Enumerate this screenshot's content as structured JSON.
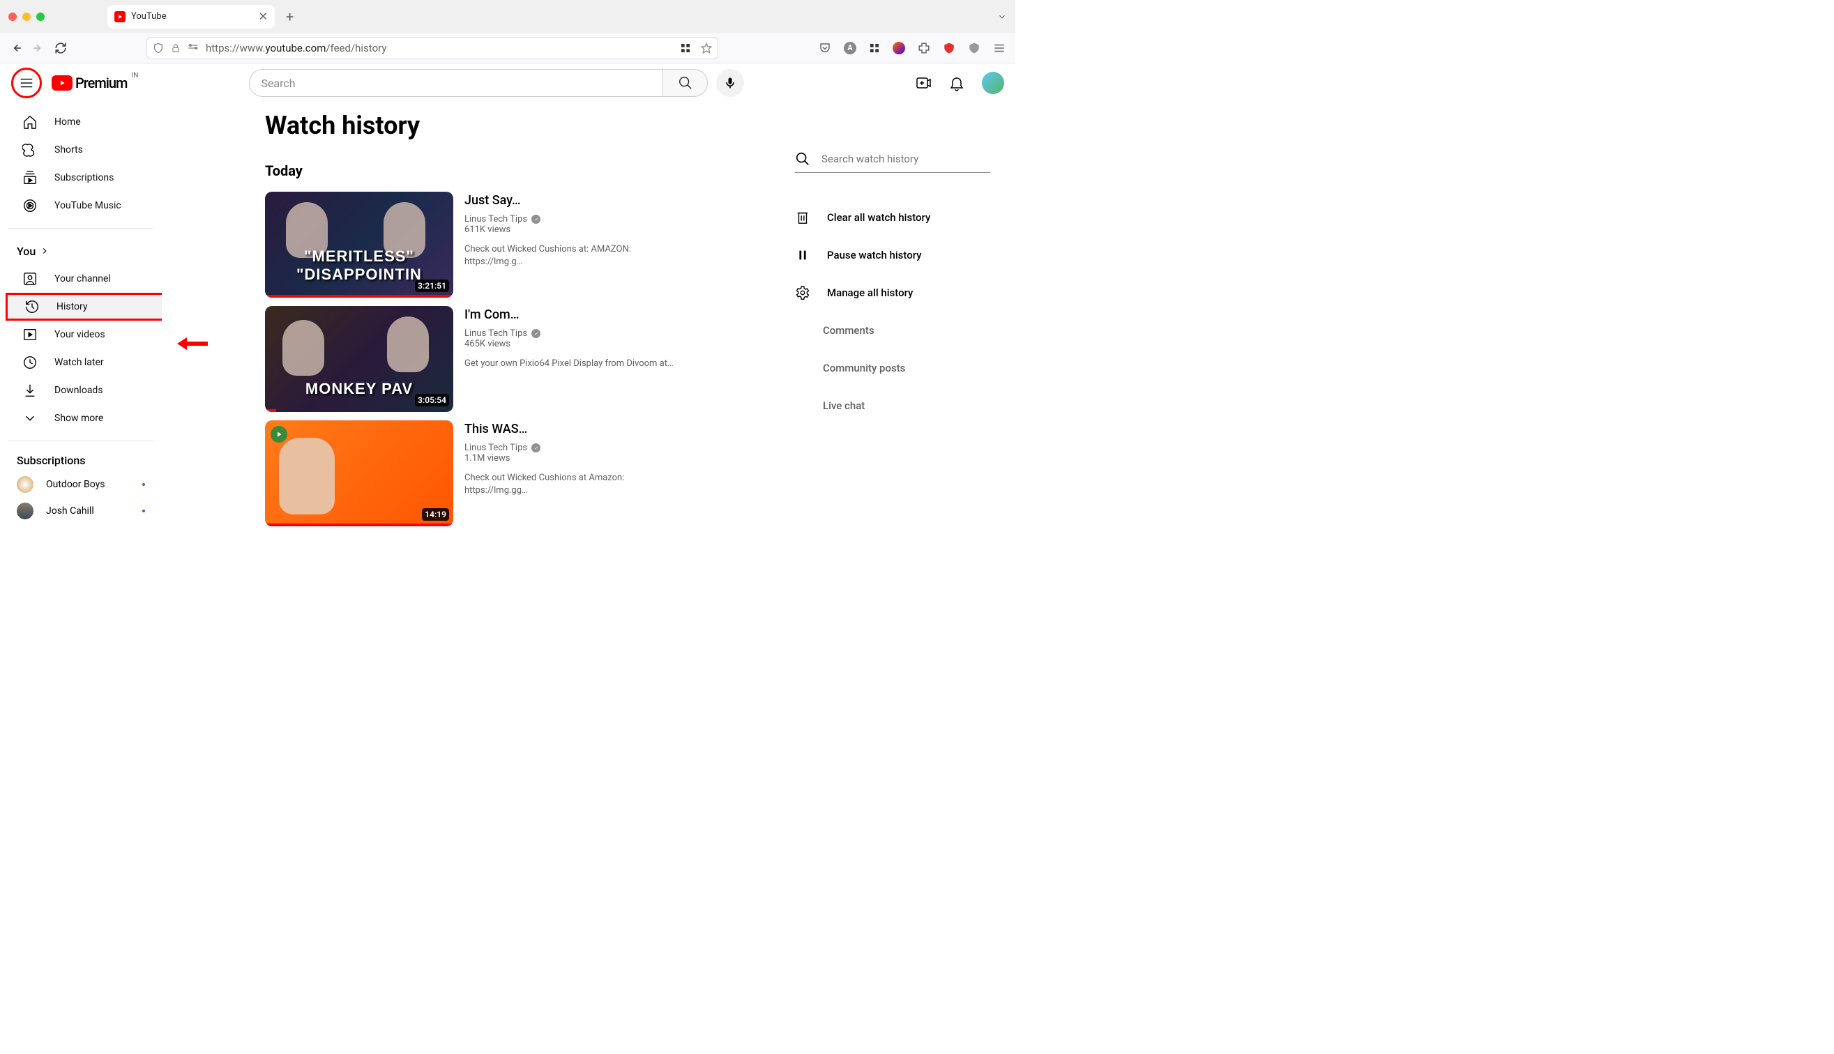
{
  "browser": {
    "tab_title": "YouTube",
    "url_prefix": "https://www.",
    "url_domain": "youtube.com",
    "url_path": "/feed/history"
  },
  "header": {
    "brand": "Premium",
    "region": "IN",
    "search_placeholder": "Search"
  },
  "sidebar": {
    "items1": [
      {
        "label": "Home"
      },
      {
        "label": "Shorts"
      },
      {
        "label": "Subscriptions"
      },
      {
        "label": "YouTube Music"
      }
    ],
    "you_label": "You",
    "items2": [
      {
        "label": "Your channel"
      },
      {
        "label": "History"
      },
      {
        "label": "Your videos"
      },
      {
        "label": "Watch later"
      },
      {
        "label": "Downloads"
      },
      {
        "label": "Show more"
      }
    ],
    "subs_header": "Subscriptions",
    "subs": [
      {
        "name": "Outdoor Boys"
      },
      {
        "name": "Josh Cahill"
      }
    ]
  },
  "page": {
    "title": "Watch history",
    "today": "Today"
  },
  "videos": [
    {
      "title": "Just Say…",
      "channel": "Linus Tech Tips",
      "views": "611K views",
      "duration": "3:21:51",
      "desc": "Check out Wicked Cushions at: AMAZON: https://lmg.g…",
      "overlay": "\"MERITLESS\" \"DISAPPOINTIN",
      "progress": 100
    },
    {
      "title": "I'm Com…",
      "channel": "Linus Tech Tips",
      "views": "465K views",
      "duration": "3:05:54",
      "desc": "Get your own Pixio64 Pixel Display from Divoom at…",
      "overlay": "MONKEY PAV",
      "progress": 6
    },
    {
      "title": "This WAS…",
      "channel": "Linus Tech Tips",
      "views": "1.1M views",
      "duration": "14:19",
      "desc": "Check out Wicked Cushions at Amazon: https://lmg.gg…",
      "overlay": "",
      "progress": 100
    }
  ],
  "side": {
    "search_placeholder": "Search watch history",
    "clear": "Clear all watch history",
    "pause": "Pause watch history",
    "manage": "Manage all history",
    "comments": "Comments",
    "community": "Community posts",
    "live": "Live chat"
  }
}
